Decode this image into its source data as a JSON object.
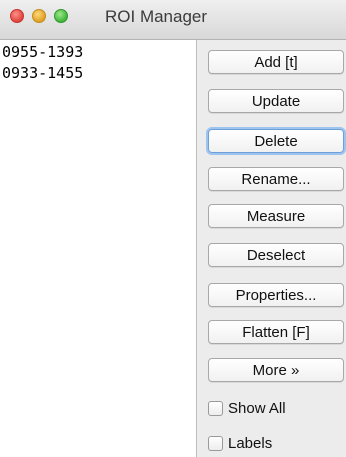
{
  "window": {
    "title": "ROI Manager"
  },
  "roi_list": [
    "0955-1393",
    "0933-1455"
  ],
  "buttons": {
    "add": "Add [t]",
    "update": "Update",
    "delete": "Delete",
    "rename": "Rename...",
    "measure": "Measure",
    "deselect": "Deselect",
    "properties": "Properties...",
    "flatten": "Flatten [F]",
    "more": "More »"
  },
  "checkboxes": {
    "show_all": "Show All",
    "labels": "Labels"
  }
}
